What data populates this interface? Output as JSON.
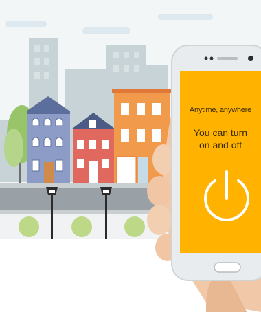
{
  "screen": {
    "tagline": "Anytime, anywhere",
    "headline_line1": "You can turn",
    "headline_line2": "on and off",
    "power_icon": "power-icon"
  },
  "colors": {
    "screen": "#ffb300",
    "sky": "#eef4f6",
    "street": "#9aa1a6"
  }
}
